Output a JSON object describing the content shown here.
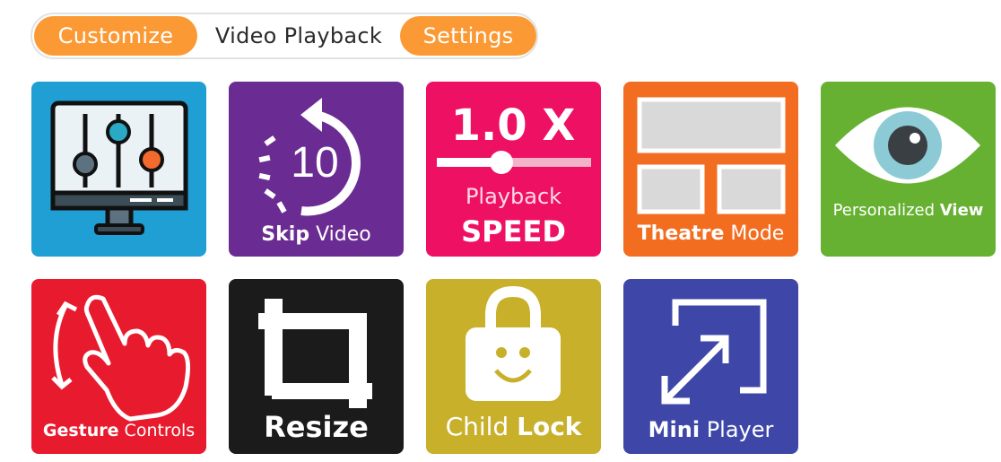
{
  "header": {
    "customize": "Customize",
    "video_playback": "Video Playback",
    "settings": "Settings"
  },
  "colors": {
    "orange": "#fb9a35",
    "customize_tile": "#1f9fd3",
    "skip_tile": "#6a2b93",
    "speed_tile": "#ee1163",
    "theatre_tile": "#f36d20",
    "view_tile": "#66b132",
    "gesture_tile": "#e81b2e",
    "resize_tile": "#1b1b1b",
    "child_lock_tile": "#c8b02b",
    "mini_player_tile": "#3e47a8"
  },
  "tiles": {
    "customize": {
      "icon": "monitor-equalizer-icon"
    },
    "skip_video": {
      "number": "10",
      "bold": "Skip",
      "normal": "Video",
      "icon": "rewind-10-icon"
    },
    "playback_speed": {
      "value": "1.0 X",
      "line1": "Playback",
      "line2": "SPEED",
      "icon": "speed-slider-icon"
    },
    "theatre_mode": {
      "bold": "Theatre",
      "normal": "Mode",
      "icon": "theatre-layout-icon"
    },
    "personalized_view": {
      "normal": "Personalized",
      "bold": "View",
      "icon": "eye-icon"
    },
    "gesture_controls": {
      "bold": "Gesture",
      "normal": "Controls",
      "icon": "hand-swipe-icon"
    },
    "resize": {
      "bold": "Resize",
      "icon": "crop-icon"
    },
    "child_lock": {
      "normal": "Child",
      "bold": "Lock",
      "icon": "smiling-lock-icon"
    },
    "mini_player": {
      "bold": "Mini",
      "normal": "Player",
      "icon": "expand-arrows-icon"
    }
  }
}
